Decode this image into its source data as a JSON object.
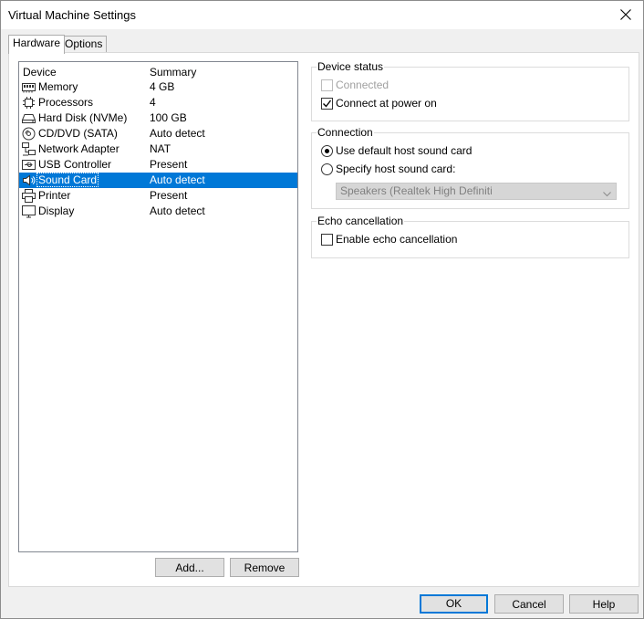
{
  "window": {
    "title": "Virtual Machine Settings"
  },
  "tabs": [
    {
      "label": "Hardware",
      "active": true
    },
    {
      "label": "Options",
      "active": false
    }
  ],
  "device_list": {
    "headers": {
      "device": "Device",
      "summary": "Summary"
    },
    "rows": [
      {
        "icon": "memory-icon",
        "name": "Memory",
        "summary": "4 GB"
      },
      {
        "icon": "processor-icon",
        "name": "Processors",
        "summary": "4"
      },
      {
        "icon": "hard-disk-icon",
        "name": "Hard Disk (NVMe)",
        "summary": "100 GB"
      },
      {
        "icon": "cd-dvd-icon",
        "name": "CD/DVD (SATA)",
        "summary": "Auto detect"
      },
      {
        "icon": "network-adapter-icon",
        "name": "Network Adapter",
        "summary": "NAT"
      },
      {
        "icon": "usb-controller-icon",
        "name": "USB Controller",
        "summary": "Present"
      },
      {
        "icon": "sound-card-icon",
        "name": "Sound Card",
        "summary": "Auto detect",
        "selected": true
      },
      {
        "icon": "printer-icon",
        "name": "Printer",
        "summary": "Present"
      },
      {
        "icon": "display-icon",
        "name": "Display",
        "summary": "Auto detect"
      }
    ],
    "add_label": "Add...",
    "remove_label": "Remove"
  },
  "device_status": {
    "title": "Device status",
    "connected_label": "Connected",
    "connected_checked": false,
    "connected_enabled": false,
    "power_on_label": "Connect at power on",
    "power_on_checked": true
  },
  "connection": {
    "title": "Connection",
    "default_label": "Use default host sound card",
    "default_selected": true,
    "specify_label": "Specify host sound card:",
    "specify_selected": false,
    "combo_value": "Speakers (Realtek High Definiti"
  },
  "echo": {
    "title": "Echo cancellation",
    "enable_label": "Enable echo cancellation",
    "enable_checked": false
  },
  "footer": {
    "ok_label": "OK",
    "cancel_label": "Cancel",
    "help_label": "Help"
  },
  "colors": {
    "selection": "#0078d7",
    "default_button_border": "#0078d7"
  }
}
